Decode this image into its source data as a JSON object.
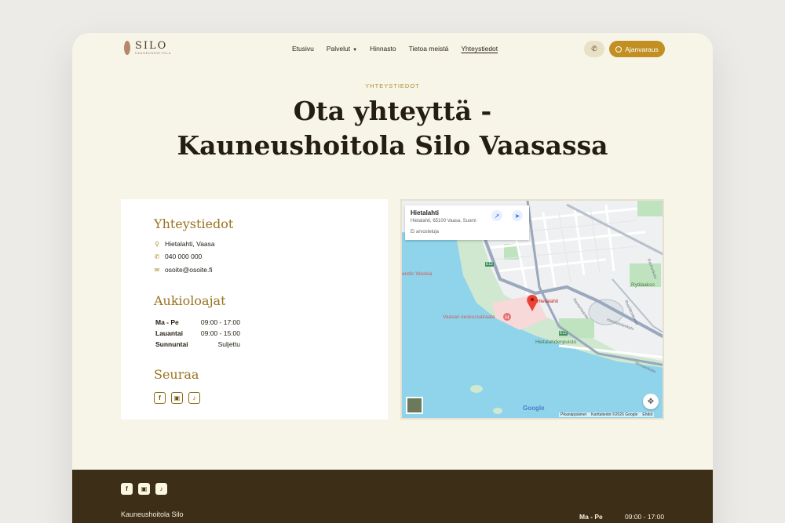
{
  "header": {
    "logo_name": "SILO",
    "logo_sub": "KAUNEUSHOITOLA",
    "nav": [
      "Etusivu",
      "Palvelut",
      "Hinnasto",
      "Tietoa meistä",
      "Yhteystiedot"
    ],
    "book_label": "Ajanvaraus"
  },
  "hero": {
    "eyebrow": "YHTEYSTIEDOT",
    "title_line1": "Ota yhteyttä -",
    "title_line2": "Kauneushoitola Silo Vaasassa"
  },
  "contact": {
    "heading": "Yhteystiedot",
    "address": "Hietalahti, Vaasa",
    "phone": "040 000 000",
    "email": "osoite@osoite.fi"
  },
  "hours": {
    "heading": "Aukioloajat",
    "rows": [
      {
        "day": "Ma - Pe",
        "time": "09:00 - 17:00"
      },
      {
        "day": "Lauantai",
        "time": "09:00 - 15:00"
      },
      {
        "day": "Sunnuntai",
        "time": "Suljettu"
      }
    ]
  },
  "follow": {
    "heading": "Seuraa",
    "icons": [
      "facebook-icon",
      "instagram-icon",
      "tiktok-icon"
    ]
  },
  "map": {
    "place": "Hietalahti",
    "address": "Hietalahti, 65100 Vaasa, Suomi",
    "reviews": "Ei arvosteluja",
    "labels": {
      "pin": "Hietalahti",
      "hospital": "Vaasan keskussairaala",
      "park": "Hietalahdenpuisto",
      "area": "Rytilaakso",
      "hotel": "andic Waskia",
      "street1": "Rantamaantie",
      "street2": "Ruuhikoskentie",
      "street3": "Rauhankatu",
      "street4": "Hietalahdenkatu",
      "street5": "Itinnaankatie",
      "road": "E12"
    },
    "google": "Google",
    "attribution": [
      "Pikanäppäimet",
      "Karttatiedot ©2026 Google",
      "Ehdot"
    ]
  },
  "footer": {
    "name": "Kauneushoitola Silo",
    "day": "Ma - Pe",
    "time": "09:00 - 17:00"
  },
  "colors": {
    "accent": "#c18f22",
    "heading_gold": "#9a7320",
    "footer_bg": "#3d2e17",
    "page_bg": "#f7f4e8"
  }
}
